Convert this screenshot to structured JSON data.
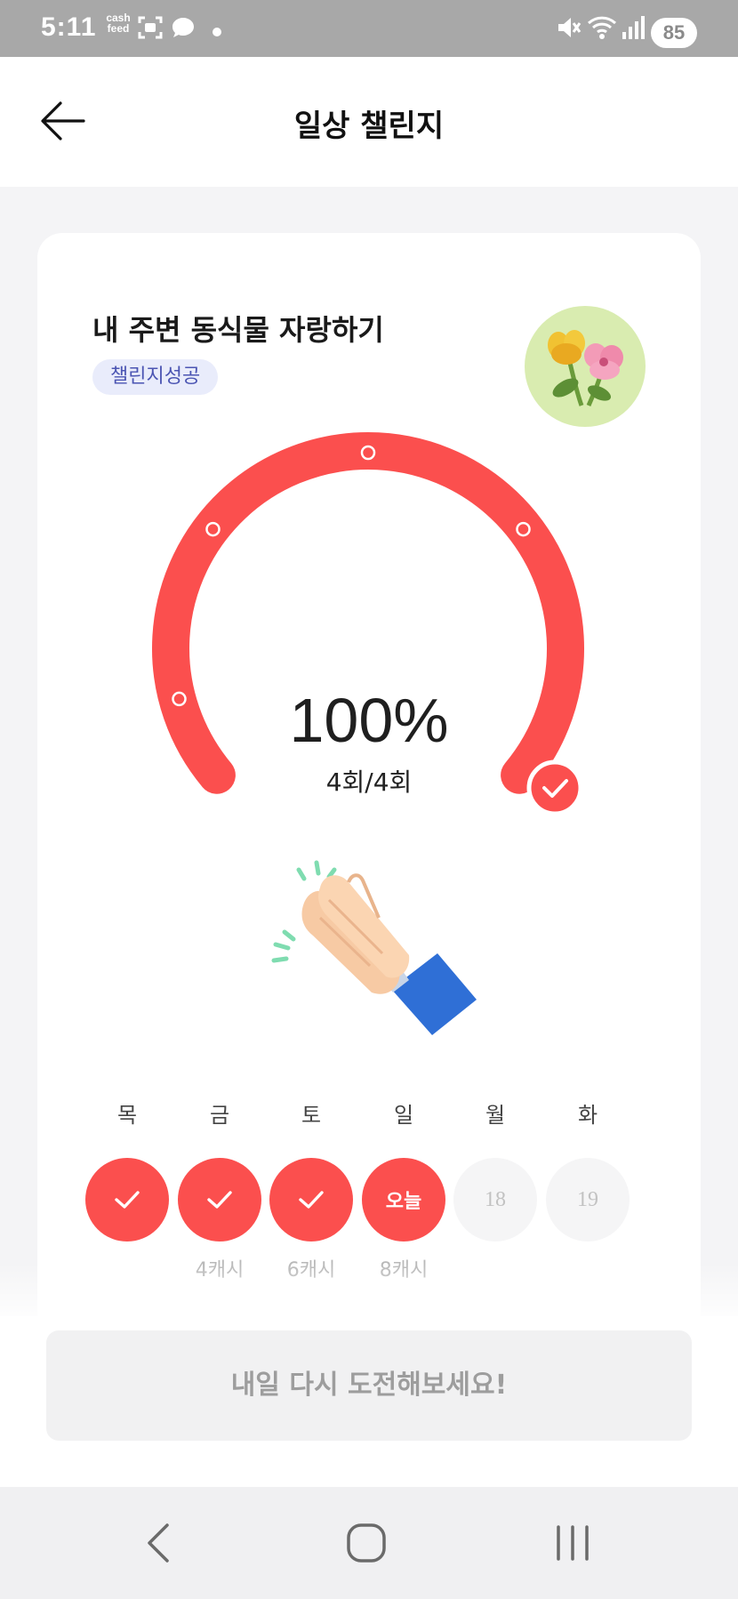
{
  "status_bar": {
    "time": "5:11",
    "cash_line1": "cash",
    "cash_line2": "feed",
    "battery": "85"
  },
  "header": {
    "title": "일상 챌린지",
    "back_icon": "arrow-left-icon"
  },
  "challenge": {
    "title": "내 주변 동식물 자랑하기",
    "status_badge": "챌린지성공",
    "thumbnail_icon": "flowers-icon"
  },
  "progress": {
    "percent_text": "100%",
    "count_text": "4회/4회",
    "fraction": 1.0,
    "completed": 4,
    "total": 4
  },
  "days": [
    {
      "label": "목",
      "state": "done",
      "text": "",
      "reward": ""
    },
    {
      "label": "금",
      "state": "done",
      "text": "",
      "reward": "4캐시"
    },
    {
      "label": "토",
      "state": "done",
      "text": "",
      "reward": "6캐시"
    },
    {
      "label": "일",
      "state": "today",
      "text": "오늘",
      "reward": "8캐시"
    },
    {
      "label": "월",
      "state": "future",
      "text": "18",
      "reward": ""
    },
    {
      "label": "화",
      "state": "future",
      "text": "19",
      "reward": ""
    }
  ],
  "retry_button": "내일 다시 도전해보세요!",
  "colors": {
    "accent": "#fb4f4e",
    "badge_bg": "#e9ecfb",
    "badge_text": "#4b55b3"
  },
  "nav": {
    "back_icon": "nav-back-icon",
    "home_icon": "nav-home-icon",
    "recents_icon": "nav-recents-icon"
  }
}
